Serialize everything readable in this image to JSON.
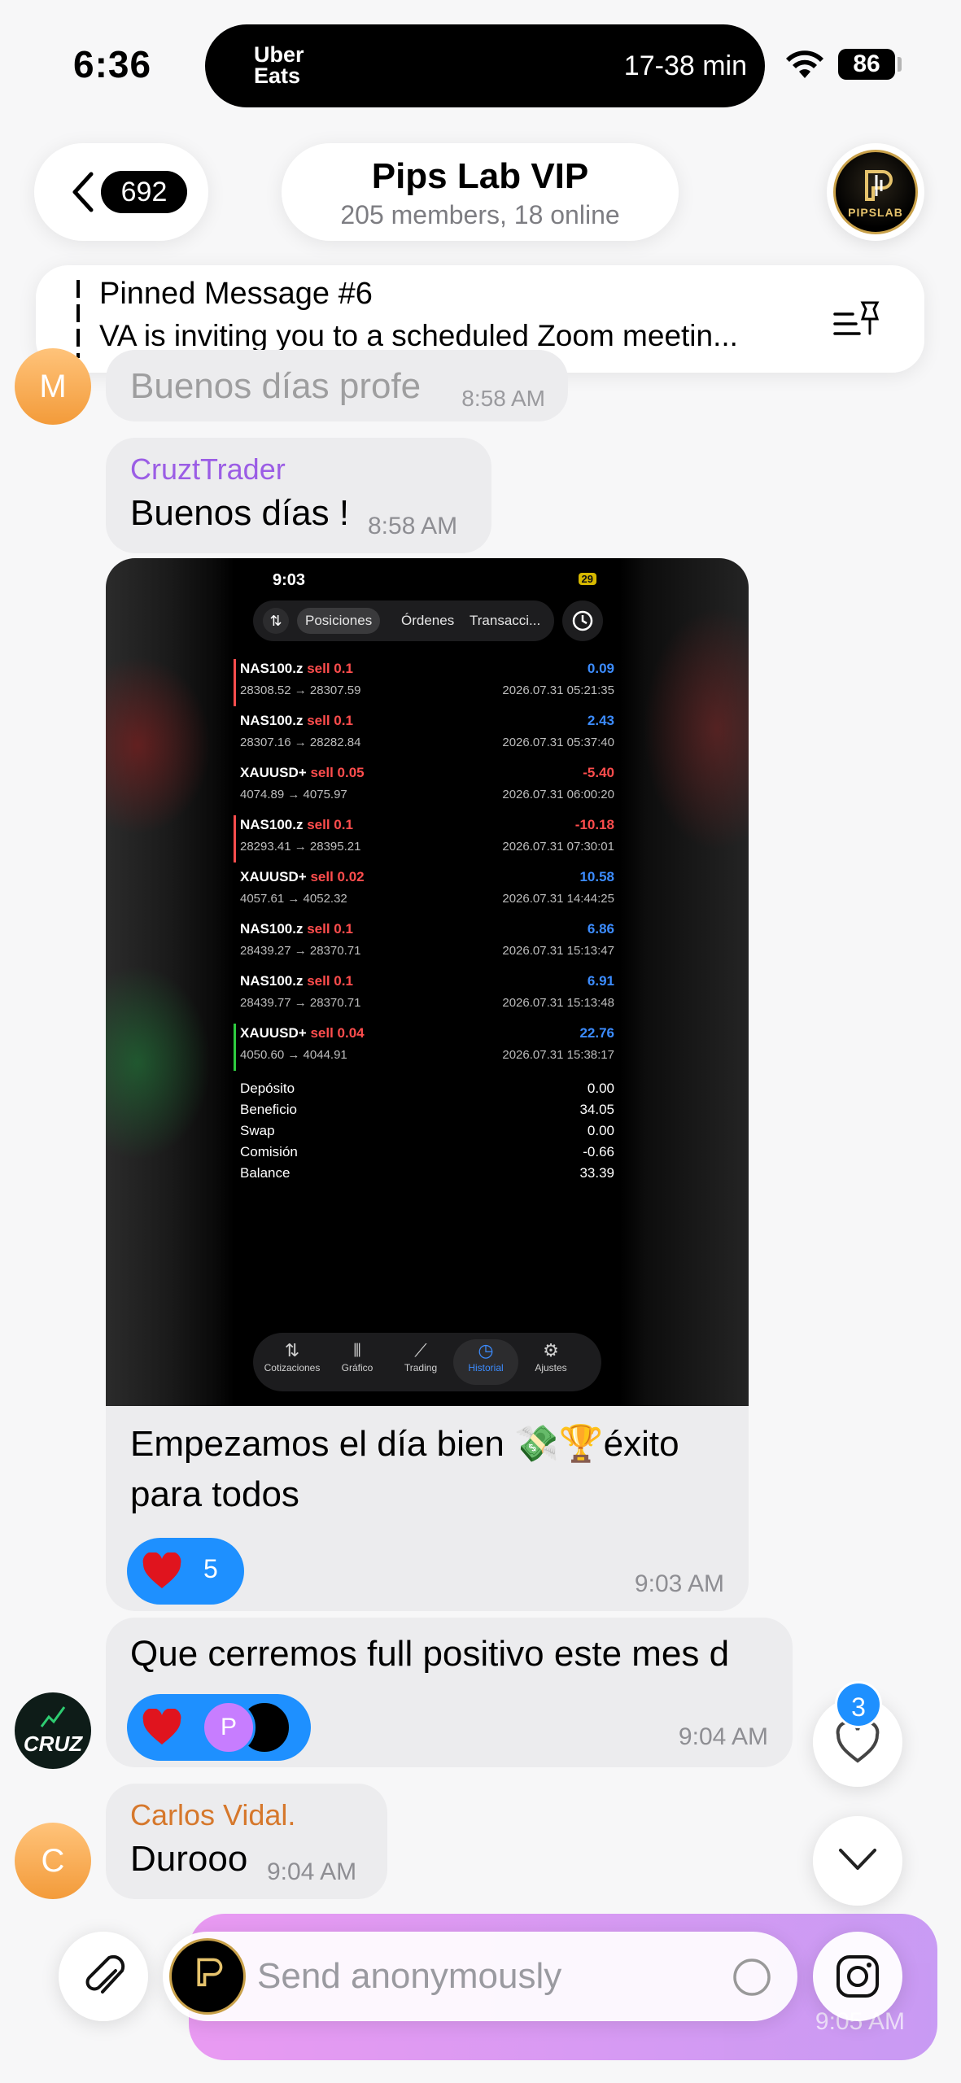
{
  "status_bar": {
    "time": "6:36",
    "eta": "17-38 min",
    "app_logo": "Uber Eats",
    "battery": "86"
  },
  "header": {
    "back_count": "692",
    "title": "Pips Lab VIP",
    "subtitle": "205 members, 18 online",
    "avatar_text": "PIPSLAB"
  },
  "pinned": {
    "title": "Pinned Message #6",
    "text": "VA is inviting you to a scheduled Zoom meetin..."
  },
  "messages": [
    {
      "avatar": "M",
      "text": "Buenos días profe",
      "time": "8:58 AM"
    },
    {
      "sender": "CruztTrader",
      "text": "Buenos días !",
      "time": "8:58 AM"
    },
    {
      "text": "Empezamos el día bien 💸🏆éxito para todos",
      "time": "9:03 AM",
      "reaction_count": "5",
      "screenshot": {
        "time": "9:03",
        "battery": "29",
        "tabs": [
          "Posiciones",
          "Órdenes",
          "Transacci..."
        ],
        "trades": [
          {
            "symbol": "NAS100.z",
            "side": "sell 0.1",
            "prices": "28308.52 → 28307.59",
            "pl": "0.09",
            "date": "2026.07.31 05:21:35",
            "pl_color": "#3c8cff",
            "bar": "#ff4d4d"
          },
          {
            "symbol": "NAS100.z",
            "side": "sell 0.1",
            "prices": "28307.16 → 28282.84",
            "pl": "2.43",
            "date": "2026.07.31 05:37:40",
            "pl_color": "#3c8cff",
            "bar": ""
          },
          {
            "symbol": "XAUUSD+",
            "side": "sell 0.05",
            "prices": "4074.89 → 4075.97",
            "pl": "-5.40",
            "date": "2026.07.31 06:00:20",
            "pl_color": "#ff4d4d",
            "bar": ""
          },
          {
            "symbol": "NAS100.z",
            "side": "sell 0.1",
            "prices": "28293.41 → 28395.21",
            "pl": "-10.18",
            "date": "2026.07.31 07:30:01",
            "pl_color": "#ff4d4d",
            "bar": "#ff4d4d"
          },
          {
            "symbol": "XAUUSD+",
            "side": "sell 0.02",
            "prices": "4057.61 → 4052.32",
            "pl": "10.58",
            "date": "2026.07.31 14:44:25",
            "pl_color": "#3c8cff",
            "bar": ""
          },
          {
            "symbol": "NAS100.z",
            "side": "sell 0.1",
            "prices": "28439.27 → 28370.71",
            "pl": "6.86",
            "date": "2026.07.31 15:13:47",
            "pl_color": "#3c8cff",
            "bar": ""
          },
          {
            "symbol": "NAS100.z",
            "side": "sell 0.1",
            "prices": "28439.77 → 28370.71",
            "pl": "6.91",
            "date": "2026.07.31 15:13:48",
            "pl_color": "#3c8cff",
            "bar": ""
          },
          {
            "symbol": "XAUUSD+",
            "side": "sell 0.04",
            "prices": "4050.60 → 4044.91",
            "pl": "22.76",
            "date": "2026.07.31 15:38:17",
            "pl_color": "#3c8cff",
            "bar": "#2ecc40"
          }
        ],
        "summary": [
          {
            "label": "Depósito",
            "value": "0.00"
          },
          {
            "label": "Beneficio",
            "value": "34.05"
          },
          {
            "label": "Swap",
            "value": "0.00"
          },
          {
            "label": "Comisión",
            "value": "-0.66"
          },
          {
            "label": "Balance",
            "value": "33.39"
          }
        ],
        "nav": [
          "Cotizaciones",
          "Gráfico",
          "Trading",
          "Historial",
          "Ajustes"
        ]
      }
    },
    {
      "avatar": "CRUZ",
      "text": "Que cerremos full positivo este mes d",
      "time": "9:04 AM",
      "reaction_avatar": "P",
      "reaction_avatar2": "PIPSLAB"
    },
    {
      "avatar": "C",
      "sender": "Carlos Vidal.",
      "text": "Durooo",
      "time": "9:04 AM"
    }
  ],
  "floating": {
    "badge_count": "3",
    "partial_time": "9:05 AM"
  },
  "composer": {
    "placeholder": "Send anonymously"
  },
  "colors": {
    "accent": "#1e90ff",
    "sender_purple": "#9b5de5",
    "sender_orange": "#d6782c",
    "bubble": "#ececee"
  }
}
